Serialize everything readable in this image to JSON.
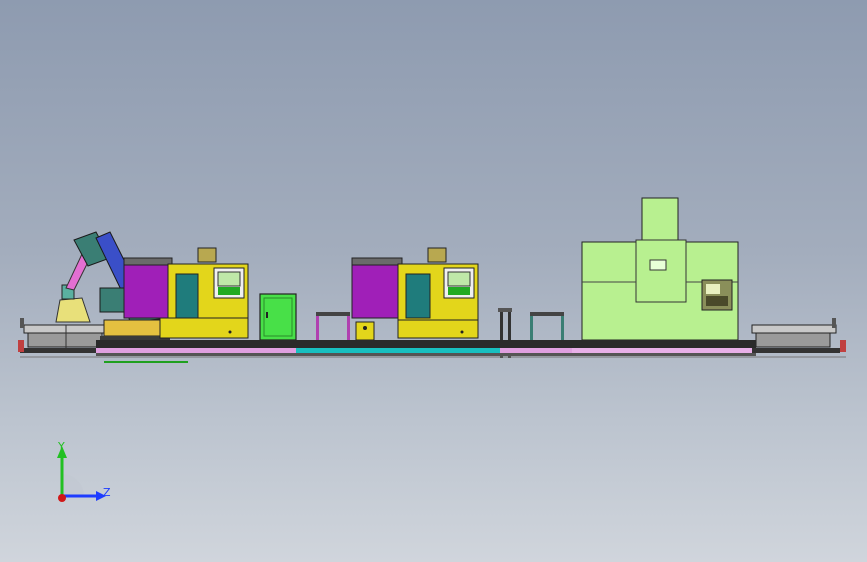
{
  "viewport": {
    "background_top": "#8e9bb0",
    "background_bottom": "#d0d5dc"
  },
  "triad": {
    "y_label": "Y",
    "z_label": "Z",
    "y_color": "#22c022",
    "z_color": "#1e3cff",
    "origin_color": "#d01818"
  },
  "model": {
    "colors": {
      "robot": "#3a7e74",
      "robot_pipe": "#e36fd2",
      "lathe_cabinet": "#a01fb8",
      "lathe_body": "#e3d61b",
      "lathe_panel": "#1f7c7c",
      "rail_cyan": "#18c0c0",
      "rail_magenta": "#b040b0",
      "green_cabinet": "#48e048",
      "machining_center": "#b8f090",
      "frame_dark": "#2a2a2a"
    }
  }
}
